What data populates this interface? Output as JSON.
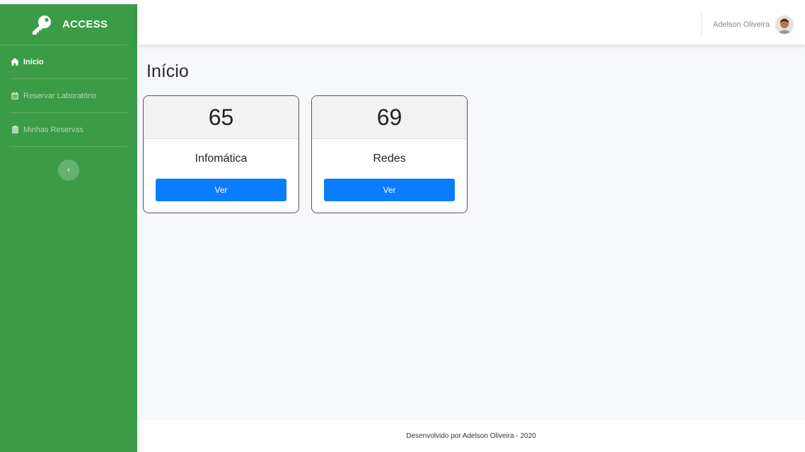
{
  "brand": {
    "name": "ACCESS",
    "icon": "key-icon"
  },
  "sidebar": {
    "items": [
      {
        "label": "Início",
        "icon": "home-icon",
        "active": true
      },
      {
        "label": "Reservar Laboratório",
        "icon": "calendar-icon",
        "active": false
      },
      {
        "label": "Minhas Reservas",
        "icon": "clipboard-icon",
        "active": false
      }
    ],
    "toggle_label": "‹"
  },
  "topbar": {
    "user_name": "Adelson Oliveira"
  },
  "main": {
    "title": "Início",
    "cards": [
      {
        "count": "65",
        "label": "Infomática",
        "button": "Ver"
      },
      {
        "count": "69",
        "label": "Redes",
        "button": "Ver"
      }
    ]
  },
  "footer": {
    "text": "Desenvolvido por Adelson Oliveira - 2020"
  },
  "colors": {
    "sidebar": "#3a9c46",
    "button": "#0a7cff",
    "background": "#f7f8fb"
  }
}
